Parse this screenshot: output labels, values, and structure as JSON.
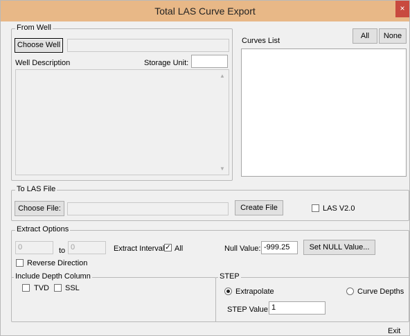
{
  "window": {
    "title": "Total LAS Curve Export",
    "close": "×"
  },
  "from_well": {
    "legend": "From Well",
    "choose_well": "Choose Well",
    "well_value": "",
    "well_description_label": "Well Description",
    "storage_unit_label": "Storage Unit:",
    "storage_unit_value": ""
  },
  "curves": {
    "label": "Curves List",
    "all_button": "All",
    "none_button": "None"
  },
  "to_las": {
    "legend": "To LAS File",
    "choose_file": "Choose File:",
    "file_value": "",
    "create_file": "Create File",
    "las_v2_label": "LAS V2.0",
    "las_v2_checked": false
  },
  "extract": {
    "legend": "Extract Options",
    "from_value": "0",
    "to_label": "to",
    "to_value": "0",
    "interval_label": "Extract Interval:",
    "interval_all_label": "All",
    "interval_all_checked": true,
    "reverse_label": "Reverse Direction",
    "reverse_checked": false,
    "null_label": "Null Value:",
    "null_value": "-999.25",
    "set_null_button": "Set NULL Value..."
  },
  "depth_column": {
    "legend": "Include Depth Column",
    "tvd_label": "TVD",
    "ssl_label": "SSL"
  },
  "step": {
    "legend": "STEP",
    "extrapolate_label": "Extrapolate",
    "curve_depths_label": "Curve Depths",
    "selected": "extrapolate",
    "step_value_label": "STEP Value:",
    "step_value": "1"
  },
  "footer": {
    "exit": "Exit"
  },
  "icons": {
    "check": "✓",
    "scroll_up": "▲",
    "scroll_down": "▼"
  }
}
